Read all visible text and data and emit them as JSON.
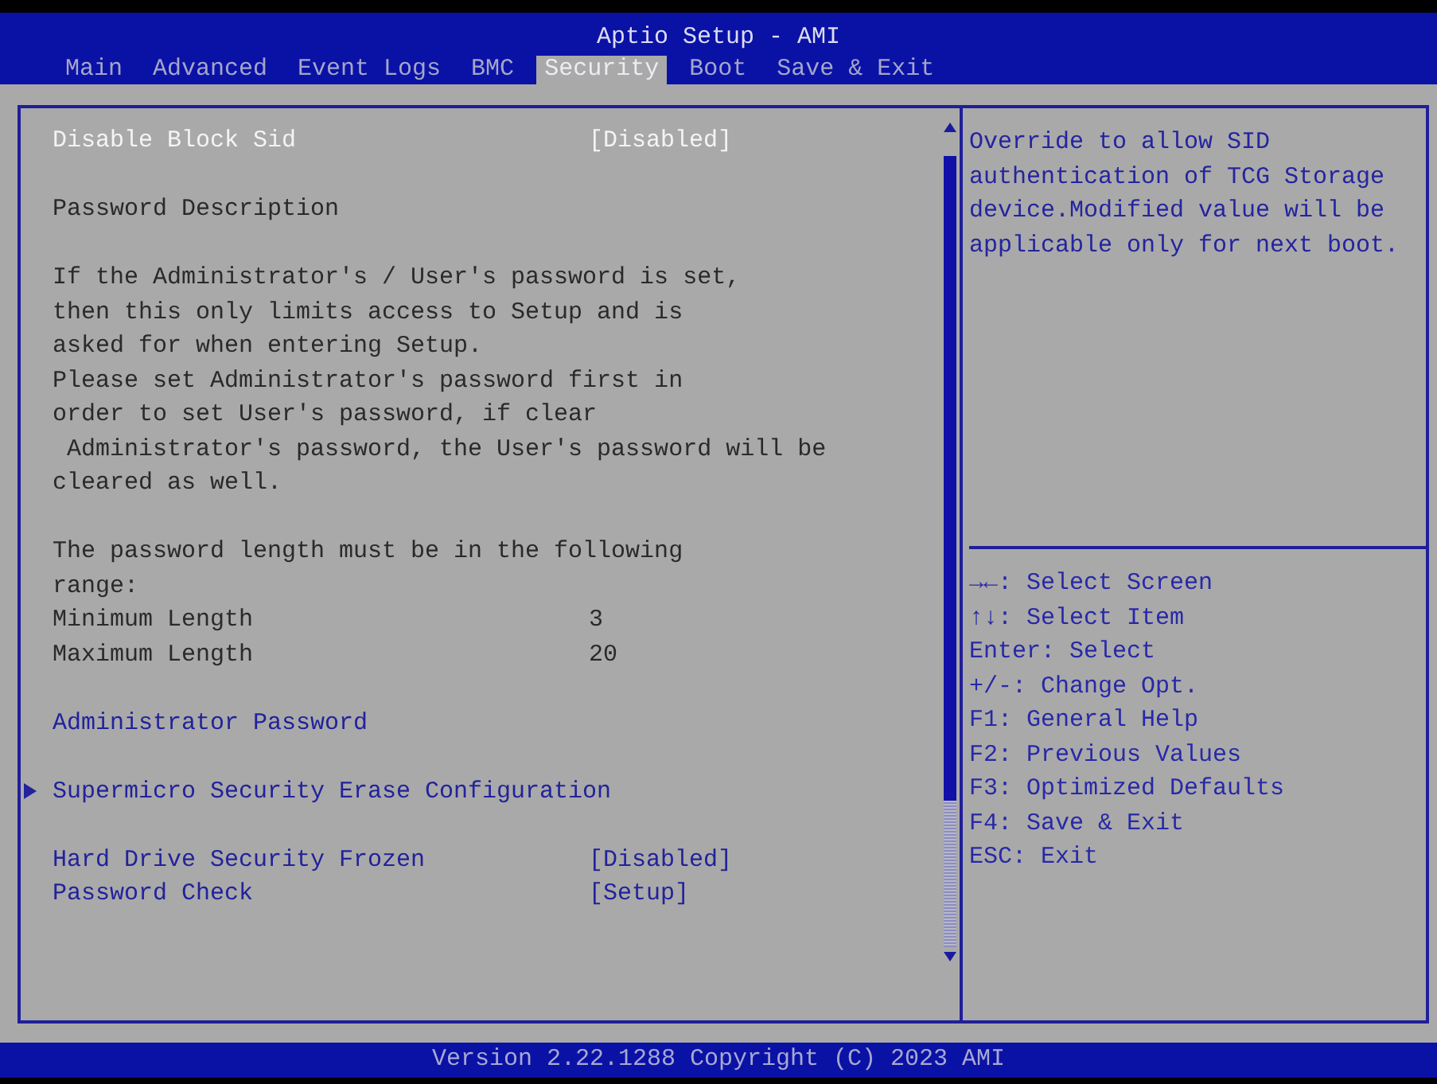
{
  "window": {
    "title": "Aptio Setup - AMI"
  },
  "tabs": [
    {
      "label": "Main",
      "selected": false
    },
    {
      "label": "Advanced",
      "selected": false
    },
    {
      "label": "Event Logs",
      "selected": false
    },
    {
      "label": "BMC",
      "selected": false
    },
    {
      "label": "Security",
      "selected": true
    },
    {
      "label": "Boot",
      "selected": false
    },
    {
      "label": "Save & Exit",
      "selected": false
    }
  ],
  "sections": [
    {
      "items": [
        {
          "kind": "option",
          "label": "Disable Block Sid",
          "value": "[Disabled]",
          "selected": true
        }
      ]
    },
    {
      "items": [
        {
          "kind": "heading",
          "text": "Password Description"
        }
      ]
    },
    {
      "items": [
        {
          "kind": "paragraph",
          "lines": [
            "If the Administrator's / User's password is set,",
            "then this only limits access to Setup and is",
            "asked for when entering Setup."
          ]
        },
        {
          "kind": "paragraph",
          "lines": [
            "Please set Administrator's password first in",
            "order to set User's password, if clear",
            " Administrator's password, the User's password will be",
            "cleared as well."
          ]
        }
      ]
    },
    {
      "items": [
        {
          "kind": "paragraph",
          "lines": [
            "The password length must be in the following",
            "range:"
          ]
        },
        {
          "kind": "info",
          "label": "Minimum Length",
          "value": "3"
        },
        {
          "kind": "info",
          "label": "Maximum Length",
          "value": "20"
        }
      ]
    },
    {
      "items": [
        {
          "kind": "action",
          "label": "Administrator Password",
          "selected": false
        }
      ]
    },
    {
      "items": [
        {
          "kind": "submenu",
          "label": "Supermicro Security Erase Configuration",
          "selected": false
        }
      ]
    },
    {
      "items": [
        {
          "kind": "option",
          "label": "Hard Drive Security Frozen",
          "value": "[Disabled]",
          "selected": false
        },
        {
          "kind": "option",
          "label": "Password Check",
          "value": "[Setup]",
          "selected": false
        }
      ]
    }
  ],
  "help": {
    "text": "Override to allow SID authentication of TCG Storage device.Modified value will be applicable only for next boot.",
    "keys": [
      "→←: Select Screen",
      "↑↓: Select Item",
      "Enter: Select",
      "+/-: Change Opt.",
      "F1: General Help",
      "F2: Previous Values",
      "F3: Optimized Defaults",
      "F4: Save & Exit",
      "ESC: Exit"
    ]
  },
  "status_bar": {
    "text": "Version 2.22.1288 Copyright (C) 2023 AMI"
  }
}
